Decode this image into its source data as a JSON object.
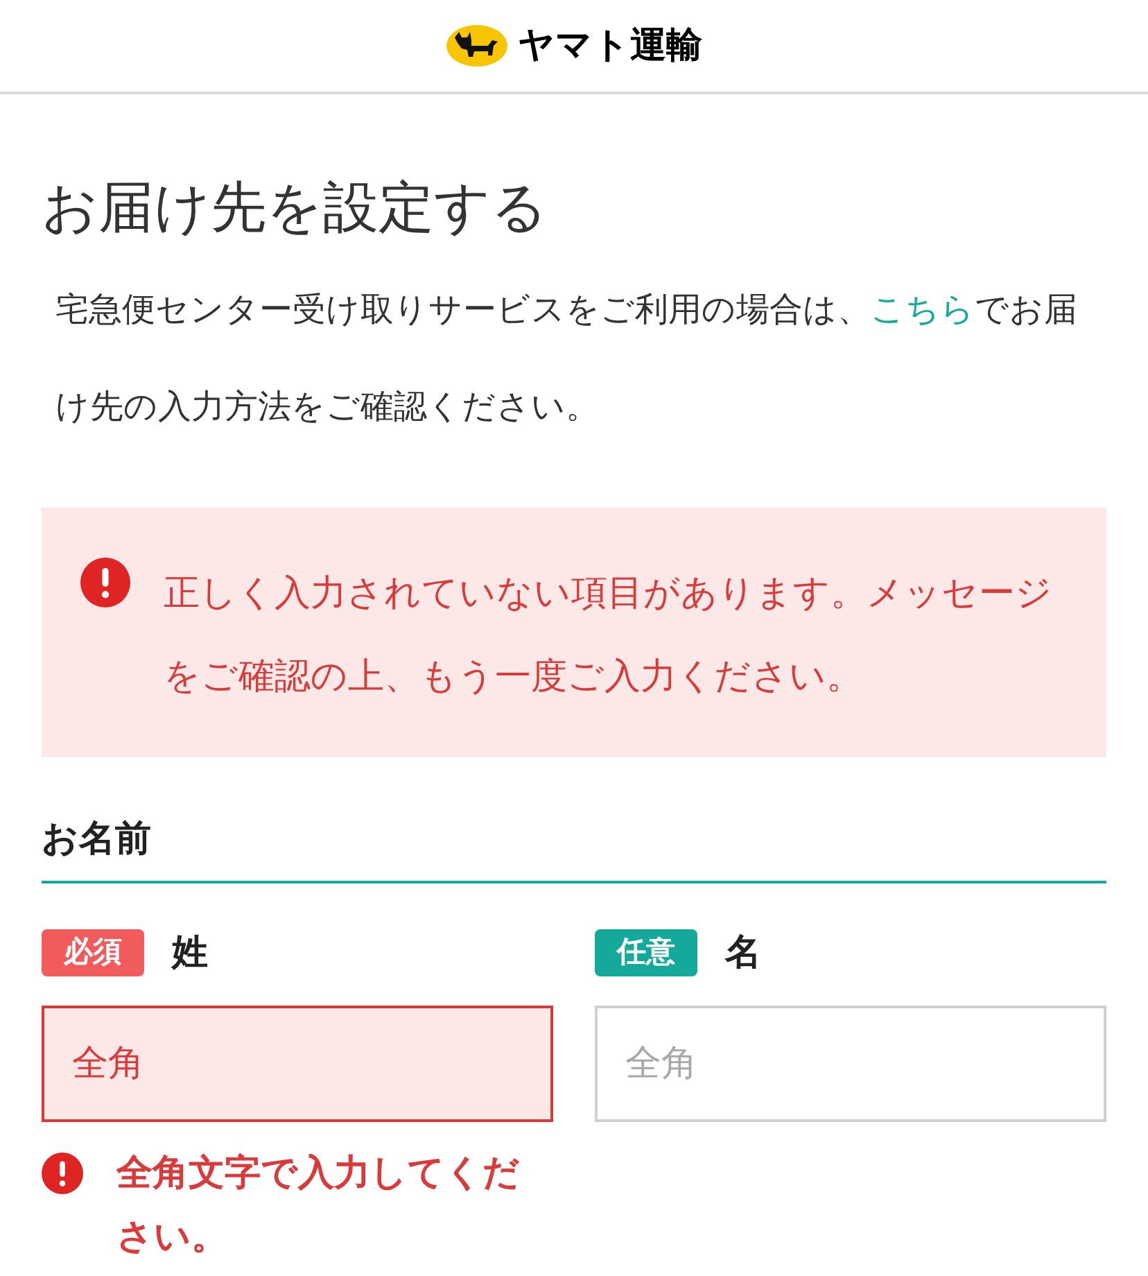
{
  "header": {
    "logo_text": "ヤマト運輸"
  },
  "title": "お届け先を設定する",
  "intro": {
    "before": "宅急便センター受け取りサービスをご利用の場合は、",
    "link": "こちら",
    "after": "でお届け先の入力方法をご確認ください。"
  },
  "alert": {
    "message": "正しく入力されていない項目があります。メッセージをご確認の上、もう一度ご入力ください。"
  },
  "section": {
    "label": "お名前"
  },
  "fields": [
    {
      "badge": "必須",
      "kind": "required",
      "label": "姓",
      "placeholder": "全角",
      "error": true,
      "error_message": "全角文字で入力してください。"
    },
    {
      "badge": "任意",
      "kind": "optional",
      "label": "名",
      "placeholder": "全角",
      "error": false
    }
  ]
}
